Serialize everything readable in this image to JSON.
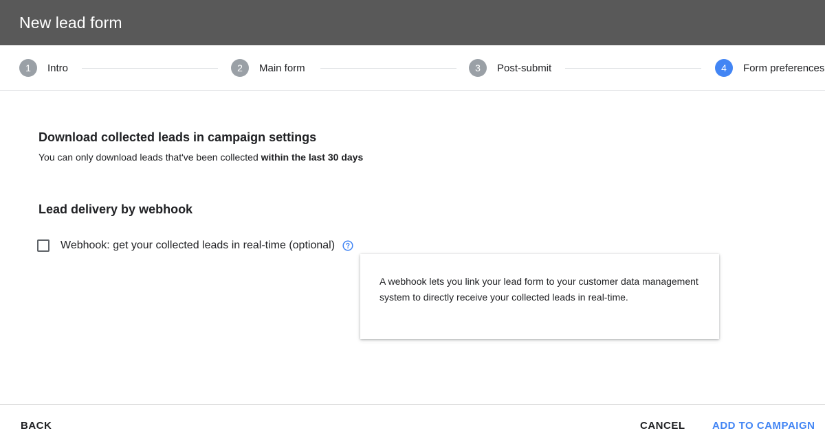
{
  "header": {
    "title": "New lead form"
  },
  "stepper": {
    "steps": [
      {
        "number": "1",
        "label": "Intro",
        "state": "inactive"
      },
      {
        "number": "2",
        "label": "Main form",
        "state": "inactive"
      },
      {
        "number": "3",
        "label": "Post-submit",
        "state": "inactive"
      },
      {
        "number": "4",
        "label": "Form preferences",
        "state": "active"
      }
    ]
  },
  "download": {
    "title": "Download collected leads in campaign settings",
    "text_prefix": "You can only download leads that've been collected ",
    "text_bold": "within the last 30 days"
  },
  "webhook": {
    "title": "Lead delivery by webhook",
    "checkbox_label": "Webhook: get your collected leads in real-time (optional)",
    "checked": false,
    "help_icon": "help-circle-icon",
    "tooltip": "A webhook lets you link your lead form to your customer data management system to directly receive your collected leads in real-time."
  },
  "footer": {
    "back_label": "BACK",
    "cancel_label": "CANCEL",
    "add_label": "ADD TO CAMPAIGN"
  },
  "colors": {
    "header_bg": "#595959",
    "accent": "#4285f4",
    "inactive_step": "#9aa0a6"
  }
}
